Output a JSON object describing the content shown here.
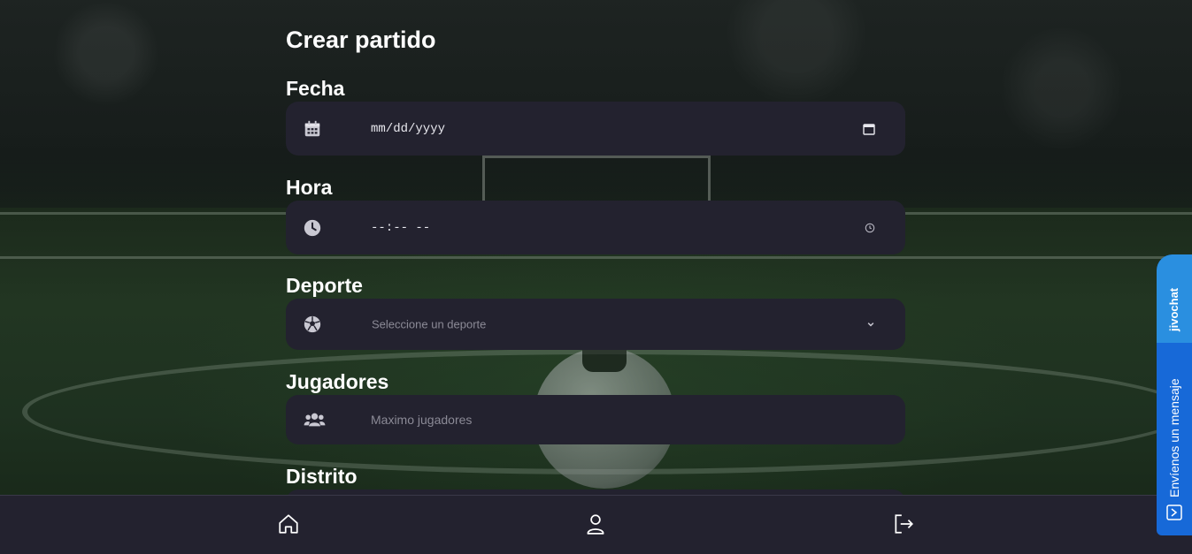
{
  "page": {
    "title": "Crear partido"
  },
  "fields": {
    "fecha": {
      "label": "Fecha",
      "value": "mm/dd/yyyy",
      "icon": "calendar-icon"
    },
    "hora": {
      "label": "Hora",
      "value": "--:-- --",
      "icon": "clock-icon"
    },
    "deporte": {
      "label": "Deporte",
      "placeholder": "Seleccione un deporte",
      "icon": "soccer-ball-icon"
    },
    "jugadores": {
      "label": "Jugadores",
      "placeholder": "Maximo jugadores",
      "icon": "users-icon"
    },
    "distrito": {
      "label": "Distrito"
    }
  },
  "navbar": {
    "items": [
      {
        "name": "home",
        "icon": "home-icon"
      },
      {
        "name": "profile",
        "icon": "user-icon"
      },
      {
        "name": "logout",
        "icon": "logout-icon"
      }
    ]
  },
  "jivochat": {
    "brand": "jivochat",
    "cta": "Envíenos un mensaje"
  },
  "colors": {
    "field_bg": "#23222f",
    "navbar_bg": "#23222f",
    "jivo_blue": "#1769d8",
    "text": "#ffffff",
    "placeholder": "#8b8a96"
  }
}
